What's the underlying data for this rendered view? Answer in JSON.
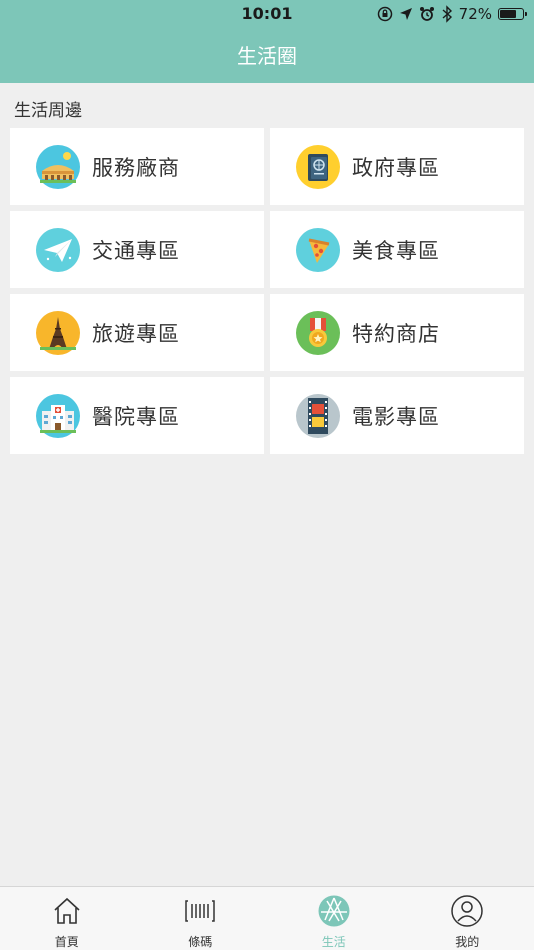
{
  "status_bar": {
    "time": "10:01",
    "battery": "72%",
    "battery_level": 0.72
  },
  "header": {
    "title": "生活圈"
  },
  "section": {
    "title": "生活周邊"
  },
  "tiles": [
    {
      "label": "服務廠商",
      "icon": "colosseum-icon"
    },
    {
      "label": "政府專區",
      "icon": "passport-icon"
    },
    {
      "label": "交通專區",
      "icon": "paper-plane-icon"
    },
    {
      "label": "美食專區",
      "icon": "pizza-icon"
    },
    {
      "label": "旅遊專區",
      "icon": "eiffel-tower-icon"
    },
    {
      "label": "特約商店",
      "icon": "medal-icon"
    },
    {
      "label": "醫院專區",
      "icon": "hospital-icon"
    },
    {
      "label": "電影專區",
      "icon": "film-strip-icon"
    }
  ],
  "tabbar": {
    "items": [
      {
        "label": "首頁",
        "icon": "home-icon"
      },
      {
        "label": "條碼",
        "icon": "barcode-icon"
      },
      {
        "label": "生活",
        "icon": "aperture-icon"
      },
      {
        "label": "我的",
        "icon": "user-icon"
      }
    ],
    "active_index": 2
  },
  "colors": {
    "accent": "#7dc6b8",
    "background": "#efefef"
  }
}
